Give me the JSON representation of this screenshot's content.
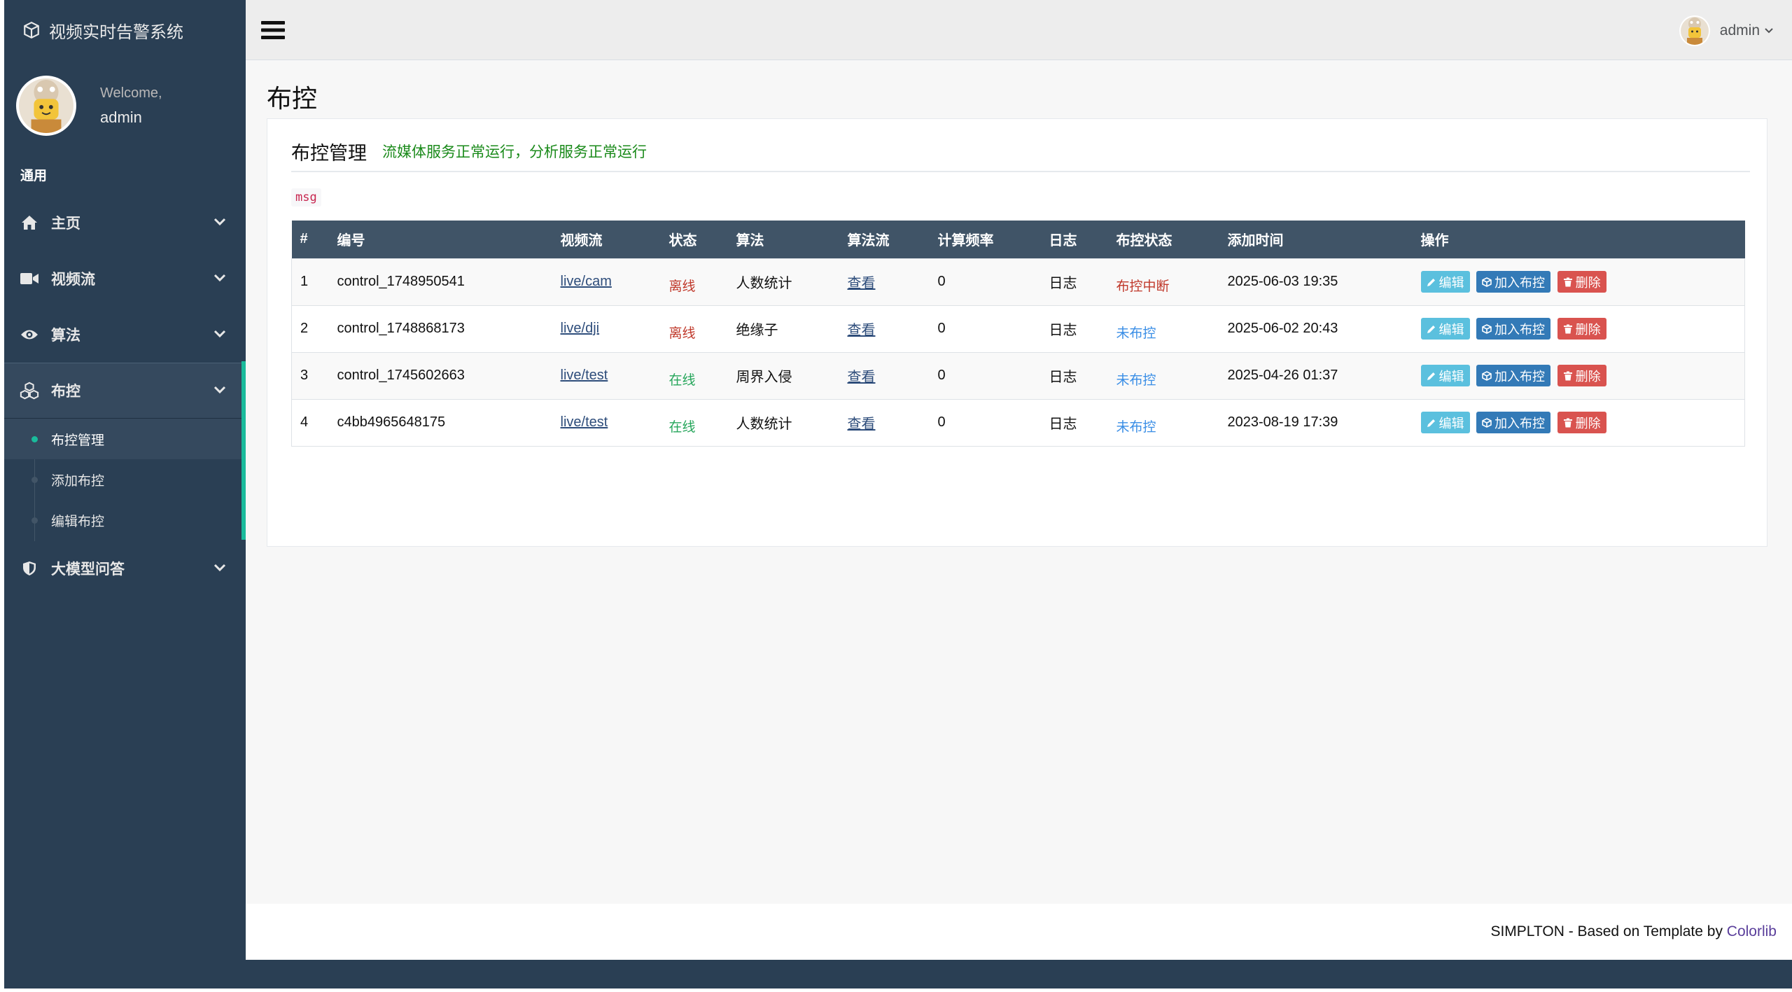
{
  "sidebar": {
    "brand": "视频实时告警系统",
    "welcome": "Welcome,",
    "username": "admin",
    "section": "通用",
    "menu": [
      {
        "label": "主页",
        "icon": "home-icon"
      },
      {
        "label": "视频流",
        "icon": "video-camera-icon"
      },
      {
        "label": "算法",
        "icon": "eye-icon"
      },
      {
        "label": "布控",
        "icon": "cubes-icon"
      },
      {
        "label": "大模型问答",
        "icon": "shield-icon"
      }
    ],
    "submenu": [
      "布控管理",
      "添加布控",
      "编辑布控"
    ]
  },
  "topbar": {
    "user": "admin"
  },
  "page": {
    "title": "布控",
    "panel_title": "布控管理",
    "service_status": "流媒体服务正常运行，分析服务正常运行",
    "msg": "msg"
  },
  "table": {
    "headers": [
      "#",
      "编号",
      "视频流",
      "状态",
      "算法",
      "算法流",
      "计算频率",
      "日志",
      "布控状态",
      "添加时间",
      "操作"
    ],
    "rows": [
      {
        "idx": "1",
        "code": "control_1748950541",
        "stream": "live/cam",
        "state": "离线",
        "algo": "人数统计",
        "algo_stream": "查看",
        "freq": "0",
        "log": "日志",
        "control_state": "布控中断",
        "time": "2025-06-03 19:35"
      },
      {
        "idx": "2",
        "code": "control_1748868173",
        "stream": "live/dji",
        "state": "离线",
        "algo": "绝缘子",
        "algo_stream": "查看",
        "freq": "0",
        "log": "日志",
        "control_state": "未布控",
        "time": "2025-06-02 20:43"
      },
      {
        "idx": "3",
        "code": "control_1745602663",
        "stream": "live/test",
        "state": "在线",
        "algo": "周界入侵",
        "algo_stream": "查看",
        "freq": "0",
        "log": "日志",
        "control_state": "未布控",
        "time": "2025-04-26 01:37"
      },
      {
        "idx": "4",
        "code": "c4bb4965648175",
        "stream": "live/test",
        "state": "在线",
        "algo": "人数统计",
        "algo_stream": "查看",
        "freq": "0",
        "log": "日志",
        "control_state": "未布控",
        "time": "2023-08-19 17:39"
      }
    ],
    "actions": {
      "edit": "编辑",
      "add": "加入布控",
      "delete": "删除"
    }
  },
  "footer": {
    "text": "SIMPLTON - Based on Template by ",
    "link": "Colorlib"
  },
  "colors": {
    "sidebar": "#2a3f54",
    "accent": "#1abb9c",
    "header": "#405467",
    "offline": "#c0392b",
    "online": "#26a65b",
    "uncontrolled": "#3a8ee6"
  }
}
